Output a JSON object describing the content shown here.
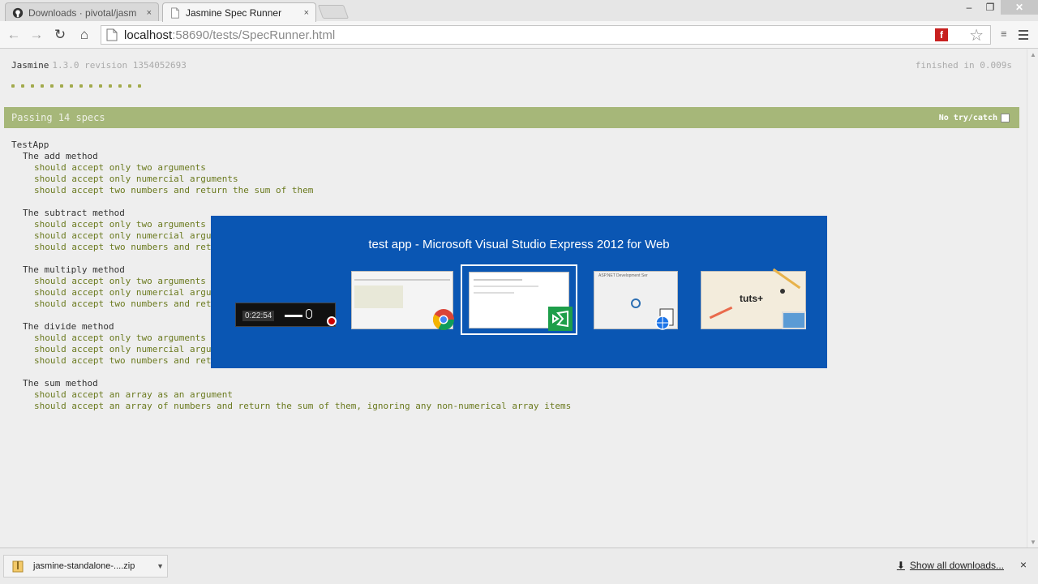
{
  "browser": {
    "tabs": [
      {
        "title": "Downloads · pivotal/jasm",
        "close": "×",
        "active": false
      },
      {
        "title": "Jasmine Spec Runner",
        "close": "×",
        "active": true
      }
    ],
    "window_controls": {
      "minimize": "–",
      "maximize": "❐",
      "close": "✕"
    },
    "url_host": "localhost",
    "url_rest": ":58690/tests/SpecRunner.html",
    "nav": {
      "back": "←",
      "forward": "→",
      "reload": "↻",
      "home": "⌂"
    }
  },
  "jasmine": {
    "name": "Jasmine",
    "version": "1.3.0 revision 1354052693",
    "duration": "finished in 0.009s",
    "dot_count": 14,
    "passing": "Passing 14 specs",
    "no_try_catch": "No try/catch",
    "root_suite": "TestApp",
    "suites": [
      {
        "title": "The add method",
        "specs": [
          "should accept only two arguments",
          "should accept only numercial arguments",
          "should accept two numbers and return the sum of them"
        ]
      },
      {
        "title": "The subtract method",
        "specs": [
          "should accept only two arguments",
          "should accept only numercial arguments",
          "should accept two numbers and return the difference of them"
        ]
      },
      {
        "title": "The multiply method",
        "specs": [
          "should accept only two arguments",
          "should accept only numercial arguments",
          "should accept two numbers and return the product of them"
        ]
      },
      {
        "title": "The divide method",
        "specs": [
          "should accept only two arguments",
          "should accept only numercial arguments",
          "should accept two numbers and return the quotient of them"
        ]
      },
      {
        "title": "The sum method",
        "specs": [
          "should accept an array as an argument",
          "should accept an array of numbers and return the sum of them, ignoring any non-numerical array items"
        ]
      }
    ]
  },
  "switcher": {
    "title": "test app - Microsoft Visual Studio Express 2012 for Web",
    "video_time": "0:22:54",
    "tuts_logo": "tuts+",
    "asp_label": "ASP.NET Development Ser",
    "colors": {
      "background": "#0a56b3",
      "selected_border": "#ffffff"
    }
  },
  "downloads": {
    "file": "jasmine-standalone-....zip",
    "show_all": "Show all downloads...",
    "close": "×"
  },
  "colors": {
    "passing_bar": "#a6b779",
    "spec_text": "#6b7a1f",
    "dot": "#a2aa4c"
  }
}
